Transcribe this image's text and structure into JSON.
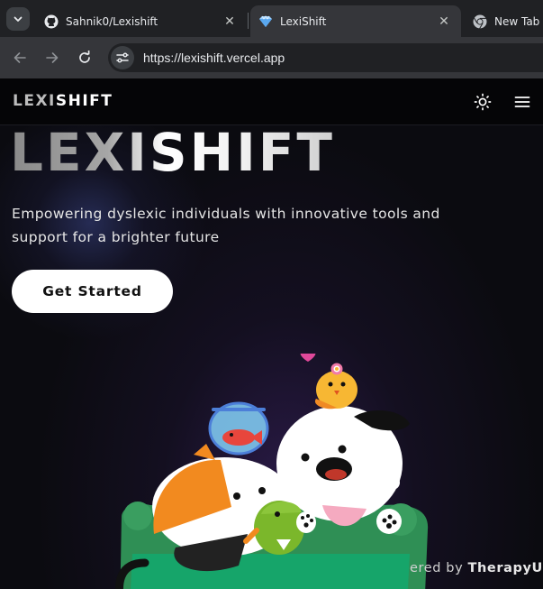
{
  "browser": {
    "tabs": [
      {
        "title": "Sahnik0/Lexishift",
        "favicon": "github-icon",
        "close": "✕"
      },
      {
        "title": "LexiShift",
        "favicon": "lexishift-favicon",
        "close": "✕"
      },
      {
        "title": "New Tab",
        "favicon": "chrome-icon"
      }
    ],
    "url": "https://lexishift.vercel.app"
  },
  "site": {
    "brand_dim": "LEXI",
    "brand_bright": "SHIFT",
    "hero_title": "LEXISHIFT",
    "hero_subtitle": "Empowering dyslexic individuals with innovative tools and support for a brighter future",
    "cta_label": "Get Started",
    "powered_prefix": "ered by ",
    "powered_name": "TherapyU"
  },
  "colors": {
    "page_bg": "#0b0b10",
    "tab_bar": "#202124",
    "toolbar": "#35363a",
    "cta_bg": "#ffffff"
  }
}
